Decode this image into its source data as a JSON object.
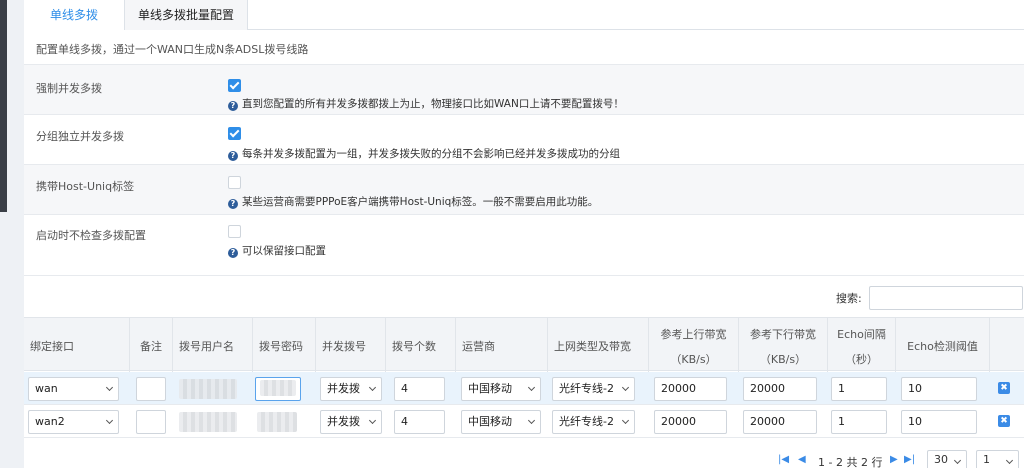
{
  "tabs": [
    {
      "label": "单线多拨"
    },
    {
      "label": "单线多拨批量配置"
    }
  ],
  "description": "配置单线多拨，通过一个WAN口生成N条ADSL拨号线路",
  "settings": [
    {
      "label": "强制并发多拨",
      "checked": true,
      "hint": "直到您配置的所有并发多拨都拨上为止，物理接口比如WAN口上请不要配置拨号！"
    },
    {
      "label": "分组独立并发多拨",
      "checked": true,
      "hint": "每条并发多拨配置为一组，并发多拨失败的分组不会影响已经并发多拨成功的分组"
    },
    {
      "label": "携带Host-Uniq标签",
      "checked": false,
      "hint": "某些运营商需要PPPoE客户端携带Host-Uniq标签。一般不需要启用此功能。"
    },
    {
      "label": "启动时不检查多拨配置",
      "checked": false,
      "hint": "可以保留接口配置"
    }
  ],
  "search": {
    "label": "搜索:",
    "value": ""
  },
  "table": {
    "headers": {
      "iface": "绑定接口",
      "note": "备注",
      "user": "拨号用户名",
      "pass": "拨号密码",
      "concurrent": "并发拨号",
      "count": "拨号个数",
      "isp": "运营商",
      "linetype": "上网类型及带宽",
      "up_l1": "参考上行带宽",
      "up_l2": "（KB/s）",
      "down_l1": "参考下行带宽",
      "down_l2": "（KB/s）",
      "echo_l1": "Echo间隔",
      "echo_l2": "（秒）",
      "threshold": "Echo检测阈值"
    },
    "rows": [
      {
        "iface": "wan",
        "note": "",
        "concurrent": "并发拨",
        "count": "4",
        "isp": "中国移动",
        "linetype": "光纤专线-2",
        "up": "20000",
        "down": "20000",
        "echo": "1",
        "threshold": "10"
      },
      {
        "iface": "wan2",
        "note": "",
        "concurrent": "并发拨",
        "count": "4",
        "isp": "中国移动",
        "linetype": "光纤专线-2",
        "up": "20000",
        "down": "20000",
        "echo": "1",
        "threshold": "10"
      }
    ]
  },
  "pager": {
    "info": "1 - 2 共 2 行",
    "page_size": "30",
    "page": "1"
  },
  "icons": {
    "help": "?",
    "delete": "✖",
    "first": "|◀",
    "prev": "◀",
    "next": "▶",
    "last": "▶|"
  },
  "colors": {
    "accent": "#2f8ee8",
    "header_bg": "#f2f4f7",
    "row_highlight": "#e9f3fc"
  }
}
